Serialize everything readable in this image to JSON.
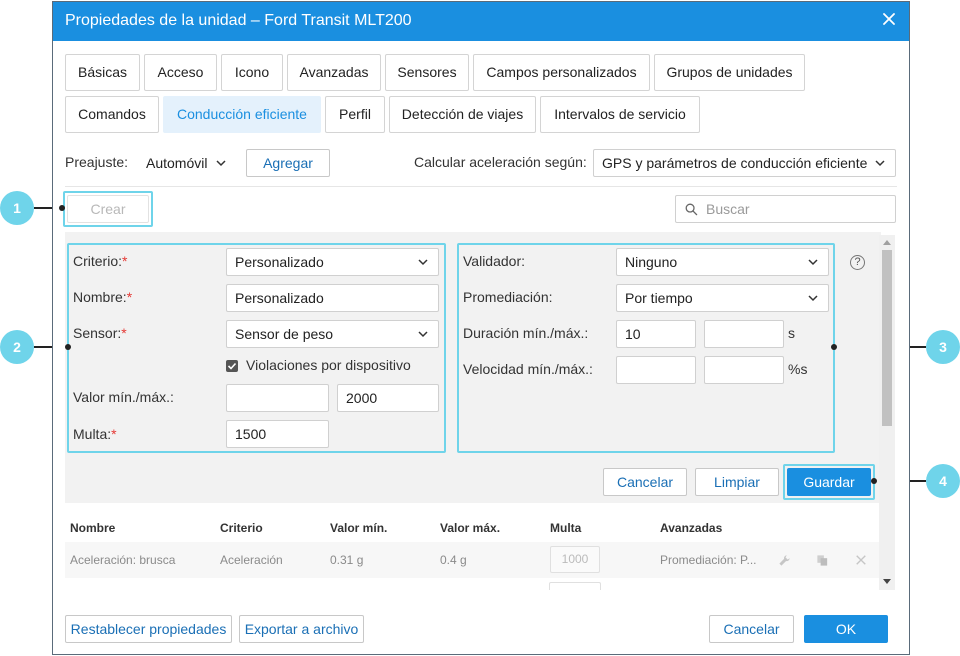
{
  "dialog": {
    "title": "Propiedades de la unidad – Ford Transit MLT200",
    "close_icon": "close-icon"
  },
  "tabs": [
    {
      "label": "Básicas",
      "active": false
    },
    {
      "label": "Acceso",
      "active": false
    },
    {
      "label": "Icono",
      "active": false
    },
    {
      "label": "Avanzadas",
      "active": false
    },
    {
      "label": "Sensores",
      "active": false
    },
    {
      "label": "Campos personalizados",
      "active": false
    },
    {
      "label": "Grupos de unidades",
      "active": false
    },
    {
      "label": "Comandos",
      "active": false
    },
    {
      "label": "Conducción eficiente",
      "active": true
    },
    {
      "label": "Perfil",
      "active": false
    },
    {
      "label": "Detección de viajes",
      "active": false
    },
    {
      "label": "Intervalos de servicio",
      "active": false
    }
  ],
  "toolbar": {
    "preset_label": "Preajuste:",
    "preset_value": "Automóvil",
    "add_label": "Agregar",
    "accel_label": "Calcular aceleración según:",
    "accel_value": "GPS y parámetros de conducción eficiente",
    "create_label": "Crear",
    "search_placeholder": "Buscar"
  },
  "form_left": {
    "criterion_label": "Criterio:",
    "criterion_value": "Personalizado",
    "name_label": "Nombre:",
    "name_value": "Personalizado",
    "sensor_label": "Sensor:",
    "sensor_value": "Sensor de peso",
    "violations_label": "Violaciones por dispositivo",
    "violations_checked": true,
    "value_minmax_label": "Valor mín./máx.:",
    "value_min": "",
    "value_max": "2000",
    "fine_label": "Multa:",
    "fine_value": "1500",
    "required_mark": "*"
  },
  "form_right": {
    "validator_label": "Validador:",
    "validator_value": "Ninguno",
    "averaging_label": "Promediación:",
    "averaging_value": "Por tiempo",
    "duration_label": "Duración mín./máx.:",
    "duration_min": "10",
    "duration_max": "",
    "duration_unit": "s",
    "speed_label": "Velocidad mín./máx.:",
    "speed_min": "",
    "speed_max": "",
    "speed_unit": "%s",
    "help_icon": "?"
  },
  "form_actions": {
    "cancel_label": "Cancelar",
    "clear_label": "Limpiar",
    "save_label": "Guardar"
  },
  "table": {
    "headers": [
      "Nombre",
      "Criterio",
      "Valor mín.",
      "Valor máx.",
      "Multa",
      "Avanzadas"
    ],
    "rows": [
      {
        "name": "Aceleración: brusca",
        "criterion": "Aceleración",
        "min": "0.31 g",
        "max": "0.4 g",
        "fine": "1000",
        "advanced": "Promediación: P..."
      }
    ]
  },
  "footer": {
    "reset_label": "Restablecer propiedades",
    "export_label": "Exportar a archivo",
    "cancel_label": "Cancelar",
    "ok_label": "OK"
  },
  "callouts": [
    "1",
    "2",
    "3",
    "4"
  ],
  "colors": {
    "accent": "#1a8fe0",
    "highlight": "#6fd4ea",
    "active_tab_bg": "#e4f1fc",
    "required": "#e53935"
  }
}
